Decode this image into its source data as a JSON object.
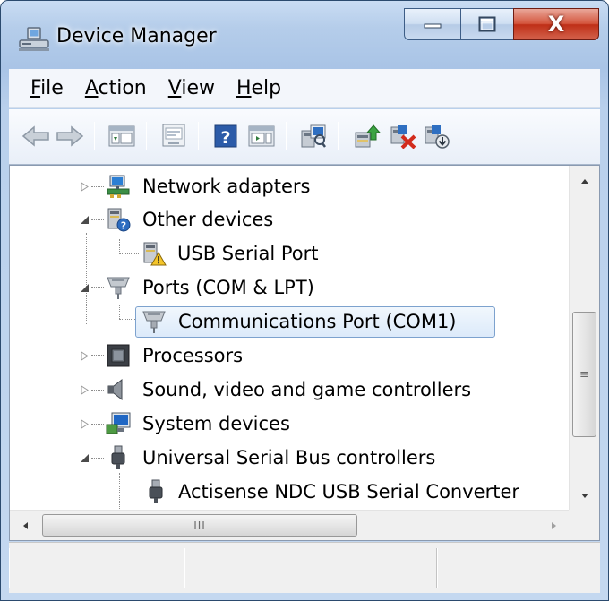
{
  "window": {
    "title": "Device Manager",
    "caption_buttons": {
      "minimize": "minimize",
      "maximize": "maximize",
      "close": "X"
    }
  },
  "menu": [
    {
      "label": "File",
      "accel": "F"
    },
    {
      "label": "Action",
      "accel": "A"
    },
    {
      "label": "View",
      "accel": "V"
    },
    {
      "label": "Help",
      "accel": "H"
    }
  ],
  "toolbar": {
    "buttons": [
      "back-icon",
      "forward-icon",
      "show-hide-console-tree-icon",
      "properties-icon",
      "help-icon",
      "show-action-pane-icon",
      "scan-hardware-icon",
      "update-driver-icon",
      "uninstall-icon",
      "disable-icon"
    ]
  },
  "tree": [
    {
      "label": "Network adapters",
      "expanded": false,
      "level": 1,
      "icon": "network-adapter-icon"
    },
    {
      "label": "Other devices",
      "expanded": true,
      "level": 1,
      "icon": "unknown-device-icon"
    },
    {
      "label": "USB Serial Port",
      "level": 2,
      "icon": "warning-device-icon"
    },
    {
      "label": "Ports (COM & LPT)",
      "expanded": true,
      "level": 1,
      "icon": "port-icon"
    },
    {
      "label": "Communications Port (COM1)",
      "level": 2,
      "icon": "port-icon",
      "selected": true
    },
    {
      "label": "Processors",
      "expanded": false,
      "level": 1,
      "icon": "processor-icon"
    },
    {
      "label": "Sound, video and game controllers",
      "expanded": false,
      "level": 1,
      "icon": "speaker-icon"
    },
    {
      "label": "System devices",
      "expanded": false,
      "level": 1,
      "icon": "system-device-icon"
    },
    {
      "label": "Universal Serial Bus controllers",
      "expanded": true,
      "level": 1,
      "icon": "usb-icon"
    },
    {
      "label": "Actisense NDC USB Serial Converter",
      "level": 2,
      "icon": "usb-icon"
    }
  ],
  "scrollbar": {
    "vertical_grip": "≡",
    "horizontal_grip": "III"
  },
  "colors": {
    "selection_border": "#7da2ce",
    "title_close": "#c9341c",
    "window_frame": "#b5cdea"
  }
}
